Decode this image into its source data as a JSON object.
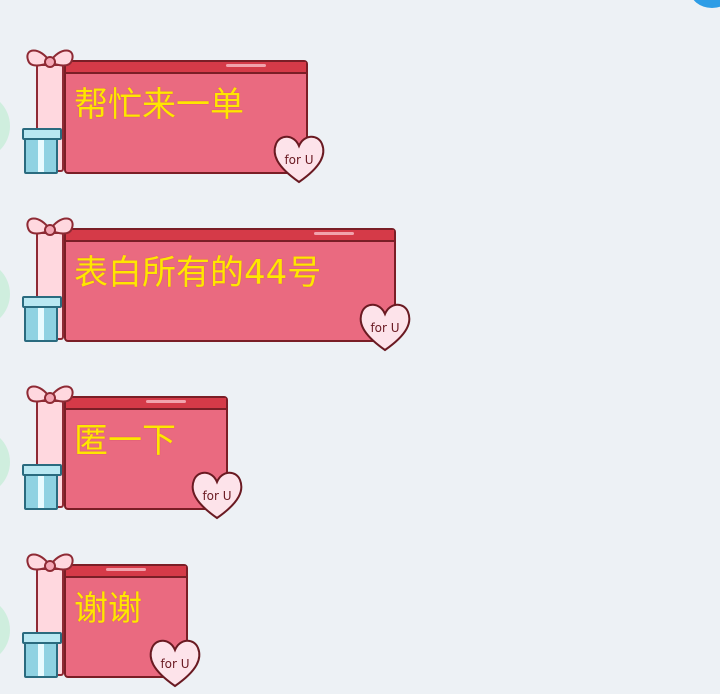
{
  "messages": [
    {
      "text": "帮忙来一单",
      "badge": "for U"
    },
    {
      "text": "表白所有的44号",
      "badge": "for U"
    },
    {
      "text": "匿一下",
      "badge": "for U"
    },
    {
      "text": "谢谢",
      "badge": "for U"
    }
  ],
  "colors": {
    "background": "#edf1f5",
    "bubble_fill": "#ea6a80",
    "bubble_trim": "#d53a48",
    "text": "#ffe600",
    "gift": "#8fd2e2",
    "avatar": "#cfeede"
  },
  "icons": [
    "gift-bow-icon",
    "gift-box-icon",
    "heart-for-u-icon",
    "avatar"
  ]
}
